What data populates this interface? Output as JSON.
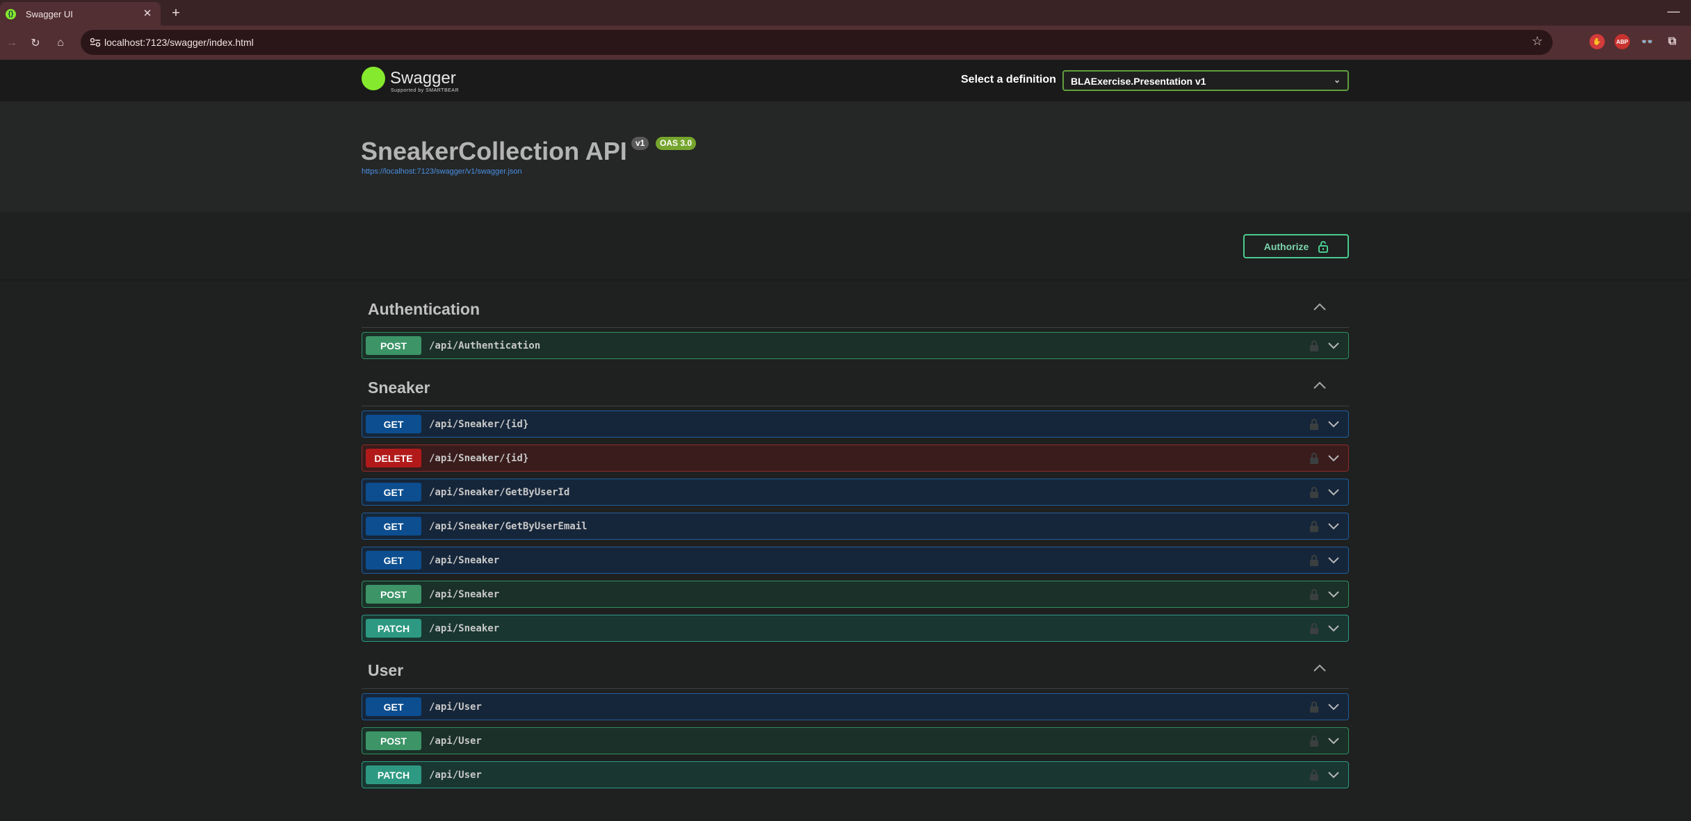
{
  "browser": {
    "tab_title": "Swagger UI",
    "tab_favicon_glyph": "{}",
    "tab_close": "✕",
    "new_tab": "+",
    "minimize": "—",
    "back": "→",
    "reload": "↻",
    "home": "⌂",
    "url": "localhost:7123/swagger/index.html",
    "star": "☆",
    "extensions": [
      {
        "name": "stop-extension-icon",
        "glyph": "✋",
        "color": "#d23b3b"
      },
      {
        "name": "adblock-extension-icon",
        "glyph": "ABP",
        "color": "#c8322f"
      },
      {
        "name": "glasses-extension-icon",
        "glyph": "👓",
        "color": "#6a6a6a"
      },
      {
        "name": "puzzle-extension-icon",
        "glyph": "⧉",
        "color": "#522f32"
      }
    ]
  },
  "swagger": {
    "logo_text": "Swagger",
    "logo_sub": "Supported by SMARTBEAR",
    "select_label": "Select a definition",
    "selected_definition": "BLAExercise.Presentation v1",
    "select_chevron": "⌄"
  },
  "info": {
    "title": "SneakerCollection API",
    "version": "v1",
    "oas": "OAS 3.0",
    "spec_url": "https://localhost:7123/swagger/v1/swagger.json"
  },
  "authorize": {
    "label": "Authorize"
  },
  "colors": {
    "get": "#0c4e8f",
    "post": "#3c9467",
    "patch": "#2e9982",
    "delete": "#b21a1a",
    "accent": "#49cc90"
  },
  "tags": [
    {
      "name": "Authentication",
      "operations": [
        {
          "method": "POST",
          "path": "/api/Authentication"
        }
      ]
    },
    {
      "name": "Sneaker",
      "operations": [
        {
          "method": "GET",
          "path": "/api/Sneaker/{id}"
        },
        {
          "method": "DELETE",
          "path": "/api/Sneaker/{id}"
        },
        {
          "method": "GET",
          "path": "/api/Sneaker/GetByUserId"
        },
        {
          "method": "GET",
          "path": "/api/Sneaker/GetByUserEmail"
        },
        {
          "method": "GET",
          "path": "/api/Sneaker"
        },
        {
          "method": "POST",
          "path": "/api/Sneaker"
        },
        {
          "method": "PATCH",
          "path": "/api/Sneaker"
        }
      ]
    },
    {
      "name": "User",
      "operations": [
        {
          "method": "GET",
          "path": "/api/User"
        },
        {
          "method": "POST",
          "path": "/api/User"
        },
        {
          "method": "PATCH",
          "path": "/api/User"
        }
      ]
    }
  ]
}
